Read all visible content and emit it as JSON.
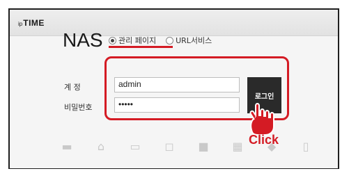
{
  "brand": {
    "small": "ip",
    "name": "TIME"
  },
  "page": {
    "title": "NAS"
  },
  "mode_options": [
    {
      "label": "관리 페이지",
      "checked": true
    },
    {
      "label": "URL서비스",
      "checked": false
    }
  ],
  "form": {
    "username_label": "계  정",
    "password_label": "비밀번호",
    "username_value": "admin",
    "password_value": "•••••",
    "login_label": "로그인"
  },
  "annotation": {
    "text": "Click",
    "color": "#d41b24"
  },
  "bottom_icons": [
    "hdd-icon",
    "network-icon",
    "monitor-icon",
    "camera-icon",
    "video-icon",
    "apps-icon",
    "usb-icon",
    "phone-icon"
  ]
}
